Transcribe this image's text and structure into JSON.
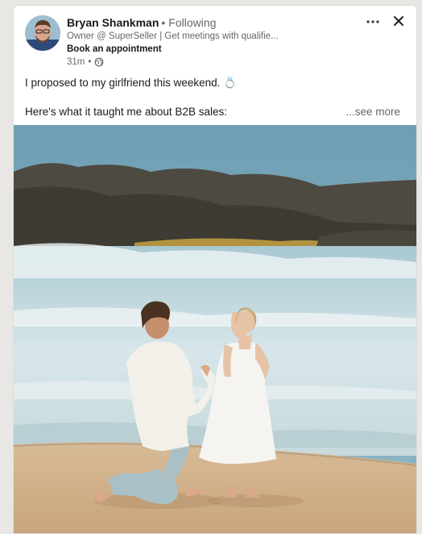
{
  "author": {
    "name": "Bryan Shankman",
    "follow_status": "Following",
    "headline": "Owner @ SuperSeller | Get meetings with qualifie...",
    "cta": "Book an appointment",
    "time": "31m",
    "visibility_icon": "globe-icon"
  },
  "controls": {
    "more_icon": "more-options-icon",
    "close_icon": "close-icon"
  },
  "post": {
    "line1": "I proposed to my girlfriend this weekend. 💍",
    "line2": "Here's what it taught me about B2B sales:",
    "see_more": "...see more"
  },
  "image": {
    "subject": "beach-proposal-photo"
  }
}
